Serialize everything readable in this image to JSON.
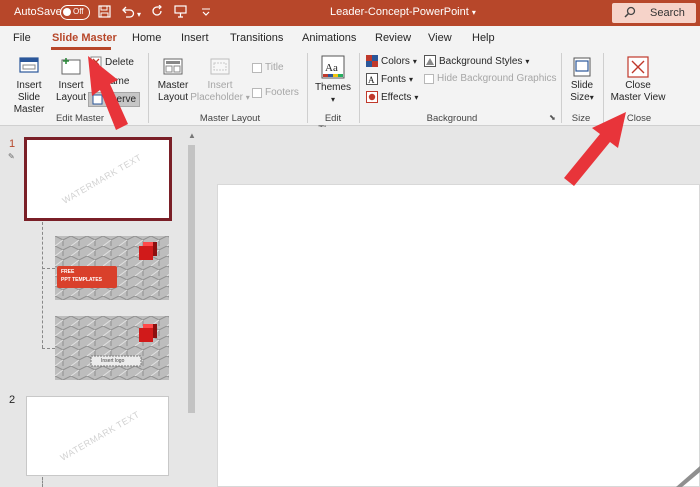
{
  "titlebar": {
    "autosave_label": "AutoSave",
    "toggle_state": "Off",
    "doc_title": "Leader-Concept-PowerPoint",
    "search_label": "Search"
  },
  "tabs": [
    "File",
    "Slide Master",
    "Home",
    "Insert",
    "Transitions",
    "Animations",
    "Review",
    "View",
    "Help"
  ],
  "active_tab": "Slide Master",
  "ribbon": {
    "edit_master": {
      "label": "Edit Master",
      "insert_slide_master": [
        "Insert Slide",
        "Master"
      ],
      "insert_layout": [
        "Insert",
        "Layout"
      ],
      "delete": "Delete",
      "rename": "ame",
      "preserve": "eserve"
    },
    "master_layout": {
      "label": "Master Layout",
      "master_layout_btn": [
        "Master",
        "Layout"
      ],
      "insert_placeholder": [
        "Insert",
        "Placeholder"
      ],
      "title": "Title",
      "footers": "Footers"
    },
    "edit_theme": {
      "label": "Edit Theme",
      "themes": "Themes"
    },
    "background": {
      "label": "Background",
      "colors": "Colors",
      "fonts": "Fonts",
      "effects": "Effects",
      "background_styles": "Background Styles",
      "hide_background_graphics": "Hide Background Graphics"
    },
    "size": {
      "label": "Size",
      "slide_size": [
        "Slide",
        "Size"
      ]
    },
    "close": {
      "label": "Close",
      "close_master_view": [
        "Close",
        "Master View"
      ]
    }
  },
  "thumbnails": {
    "slide1_number": "1",
    "slide2_number": "2",
    "watermark_text": "WATERMARK TEXT",
    "layout1_text": [
      "FREE",
      "PPT TEMPLATES"
    ],
    "layout2_text": "Insert logo"
  },
  "colors": {
    "accent": "#b7472a",
    "annotation_arrow": "#e8343a"
  }
}
